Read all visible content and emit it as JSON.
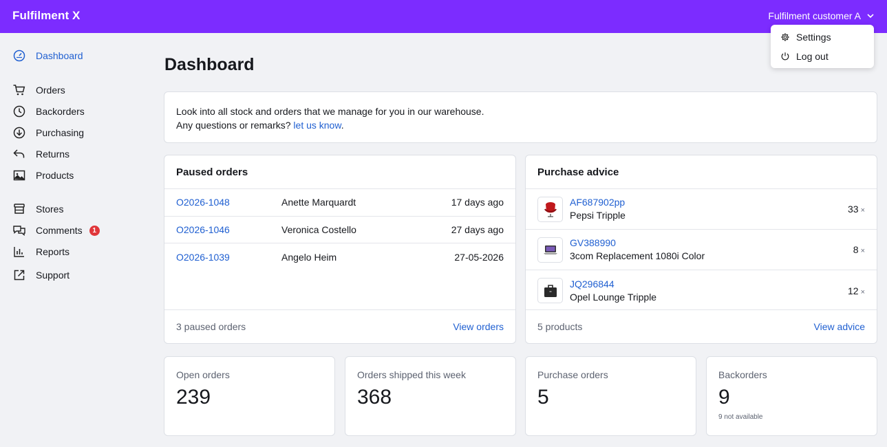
{
  "app": {
    "title": "Fulfilment X"
  },
  "account": {
    "name": "Fulfilment customer A",
    "menu": [
      {
        "label": "Settings",
        "icon": "gear-icon"
      },
      {
        "label": "Log out",
        "icon": "power-icon"
      }
    ]
  },
  "sidebar": {
    "items": [
      {
        "label": "Dashboard",
        "icon": "dashboard-gauge-icon",
        "active": true
      },
      {
        "label": "Orders",
        "icon": "cart-icon"
      },
      {
        "label": "Backorders",
        "icon": "clock-icon"
      },
      {
        "label": "Purchasing",
        "icon": "download-circle-icon"
      },
      {
        "label": "Returns",
        "icon": "return-arrow-icon"
      },
      {
        "label": "Products",
        "icon": "image-icon"
      },
      {
        "label": "Stores",
        "icon": "store-icon"
      },
      {
        "label": "Comments",
        "icon": "chat-bubbles-icon",
        "badge": "1"
      },
      {
        "label": "Reports",
        "icon": "bar-chart-icon"
      },
      {
        "label": "Support",
        "icon": "external-link-icon"
      }
    ]
  },
  "page": {
    "title": "Dashboard",
    "intro_line1": "Look into all stock and orders that we manage for you in our warehouse.",
    "intro_line2_prefix": "Any questions or remarks?",
    "intro_link": "let us know",
    "intro_line2_suffix": "."
  },
  "paused_orders": {
    "title": "Paused orders",
    "rows": [
      {
        "id": "O2026-1048",
        "customer": "Anette Marquardt",
        "when": "17 days ago"
      },
      {
        "id": "O2026-1046",
        "customer": "Veronica Costello",
        "when": "27 days ago"
      },
      {
        "id": "O2026-1039",
        "customer": "Angelo Heim",
        "when": "27-05-2026"
      }
    ],
    "footer_count": "3 paused orders",
    "footer_link": "View orders"
  },
  "purchase_advice": {
    "title": "Purchase advice",
    "rows": [
      {
        "sku": "AF687902pp",
        "name": "Pepsi Tripple",
        "qty": "33",
        "thumb": "red-chair"
      },
      {
        "sku": "GV388990",
        "name": "3com Replacement 1080i Color",
        "qty": "8",
        "thumb": "laptop"
      },
      {
        "sku": "JQ296844",
        "name": "Opel Lounge Tripple",
        "qty": "12",
        "thumb": "briefcase"
      }
    ],
    "qty_suffix": "×",
    "footer_count": "5 products",
    "footer_link": "View advice"
  },
  "stats": [
    {
      "label": "Open orders",
      "value": "239"
    },
    {
      "label": "Orders shipped this week",
      "value": "368"
    },
    {
      "label": "Purchase orders",
      "value": "5"
    },
    {
      "label": "Backorders",
      "value": "9",
      "sub": "9 not available"
    }
  ],
  "colors": {
    "brand": "#7c2cff",
    "link": "#1f5fd1",
    "badge": "#e0363a"
  }
}
